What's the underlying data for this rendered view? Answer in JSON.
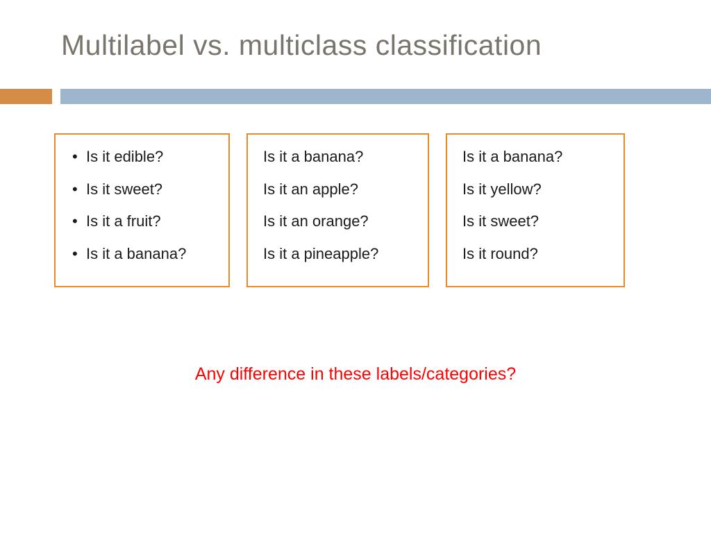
{
  "title": "Multilabel vs. multiclass classification",
  "boxes": {
    "box0": {
      "item0": "Is it edible?",
      "item1": "Is it sweet?",
      "item2": "Is it a fruit?",
      "item3": "Is it a banana?"
    },
    "box1": {
      "item0": "Is it a banana?",
      "item1": "Is it an apple?",
      "item2": "Is it an orange?",
      "item3": "Is it a pineapple?"
    },
    "box2": {
      "item0": "Is it a banana?",
      "item1": "Is it yellow?",
      "item2": "Is it sweet?",
      "item3": "Is it round?"
    }
  },
  "question": "Any difference in these labels/categories?",
  "colors": {
    "title": "#7a756c",
    "accent_orange": "#d48c47",
    "accent_blue": "#9db6ce",
    "box_border": "#e88a2a",
    "question": "#ff0000"
  }
}
